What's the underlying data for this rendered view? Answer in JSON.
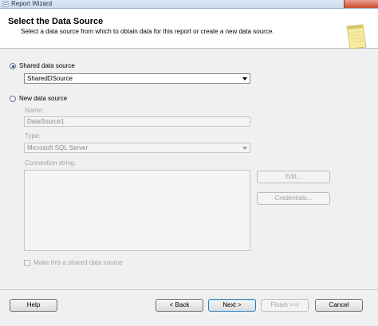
{
  "window": {
    "title": "Report Wizard"
  },
  "header": {
    "title": "Select the Data Source",
    "subtitle": "Select a data source from which to obtain data for this report or create a new data source."
  },
  "shared": {
    "label": "Shared data source",
    "selected": true,
    "value": "SharedDSource"
  },
  "new_source": {
    "label": "New data source",
    "selected": false,
    "name_label": "Name:",
    "name_value": "DataSource1",
    "type_label": "Type:",
    "type_value": "Microsoft SQL Server",
    "conn_label": "Connection string:",
    "conn_value": "",
    "edit_label": "Edit...",
    "credentials_label": "Credentials...",
    "shared_checkbox_label": "Make this a shared data source",
    "shared_checkbox_checked": false
  },
  "footer": {
    "help": "Help",
    "back": "< Back",
    "next": "Next >",
    "finish": "Finish >>|",
    "cancel": "Cancel"
  }
}
